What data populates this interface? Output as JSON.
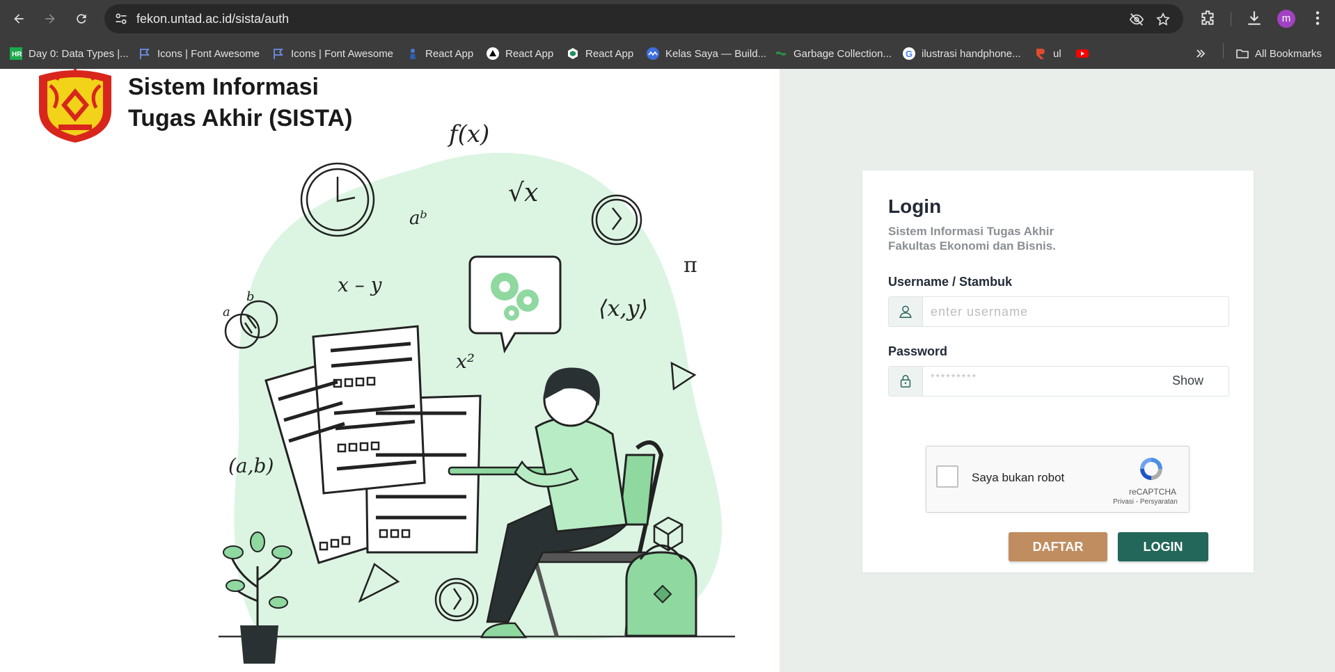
{
  "browser": {
    "url": "fekon.untad.ac.id/sista/auth",
    "profile_initial": "m",
    "bookmarks": [
      {
        "label": "Day 0: Data Types |...",
        "icon": "hackerrank-icon"
      },
      {
        "label": "Icons | Font Awesome",
        "icon": "flag-icon"
      },
      {
        "label": "Icons | Font Awesome",
        "icon": "flag-icon"
      },
      {
        "label": "React App",
        "icon": "react-figure-icon"
      },
      {
        "label": "React App",
        "icon": "triangle-icon"
      },
      {
        "label": "React App",
        "icon": "hex-icon"
      },
      {
        "label": "Kelas Saya — Build...",
        "icon": "wave-icon"
      },
      {
        "label": "Garbage Collection...",
        "icon": "gfg-icon"
      },
      {
        "label": "ilustrasi handphone...",
        "icon": "google-icon"
      },
      {
        "label": "ul",
        "icon": "r-logo-icon"
      },
      {
        "label": "",
        "icon": "youtube-icon"
      }
    ],
    "all_bookmarks": "All Bookmarks"
  },
  "brand": {
    "line1": "Sistem Informasi",
    "line2": "Tugas Akhir (SISTA)"
  },
  "illustration": {
    "formulas": [
      "f(x)",
      "√x",
      "aᵇ",
      "x – y",
      "⟨x,y⟩",
      "x²",
      "(a,b)",
      "a",
      "b",
      "π"
    ]
  },
  "login": {
    "title": "Login",
    "subtitle_line1": "Sistem Informasi Tugas Akhir",
    "subtitle_line2": "Fakultas Ekonomi dan Bisnis.",
    "username_label": "Username / Stambuk",
    "username_placeholder": "enter username",
    "password_label": "Password",
    "password_mask": "*********",
    "show_label": "Show",
    "captcha_label": "Saya bukan robot",
    "captcha_brand": "reCAPTCHA",
    "captcha_links": "Privasi - Persyaratan",
    "daftar_label": "DAFTAR",
    "login_label": "LOGIN"
  },
  "colors": {
    "daftar": "#c08d60",
    "login": "#23665a",
    "right_pane": "#e9eeeb",
    "illustration_accent": "#8fd8a0"
  }
}
